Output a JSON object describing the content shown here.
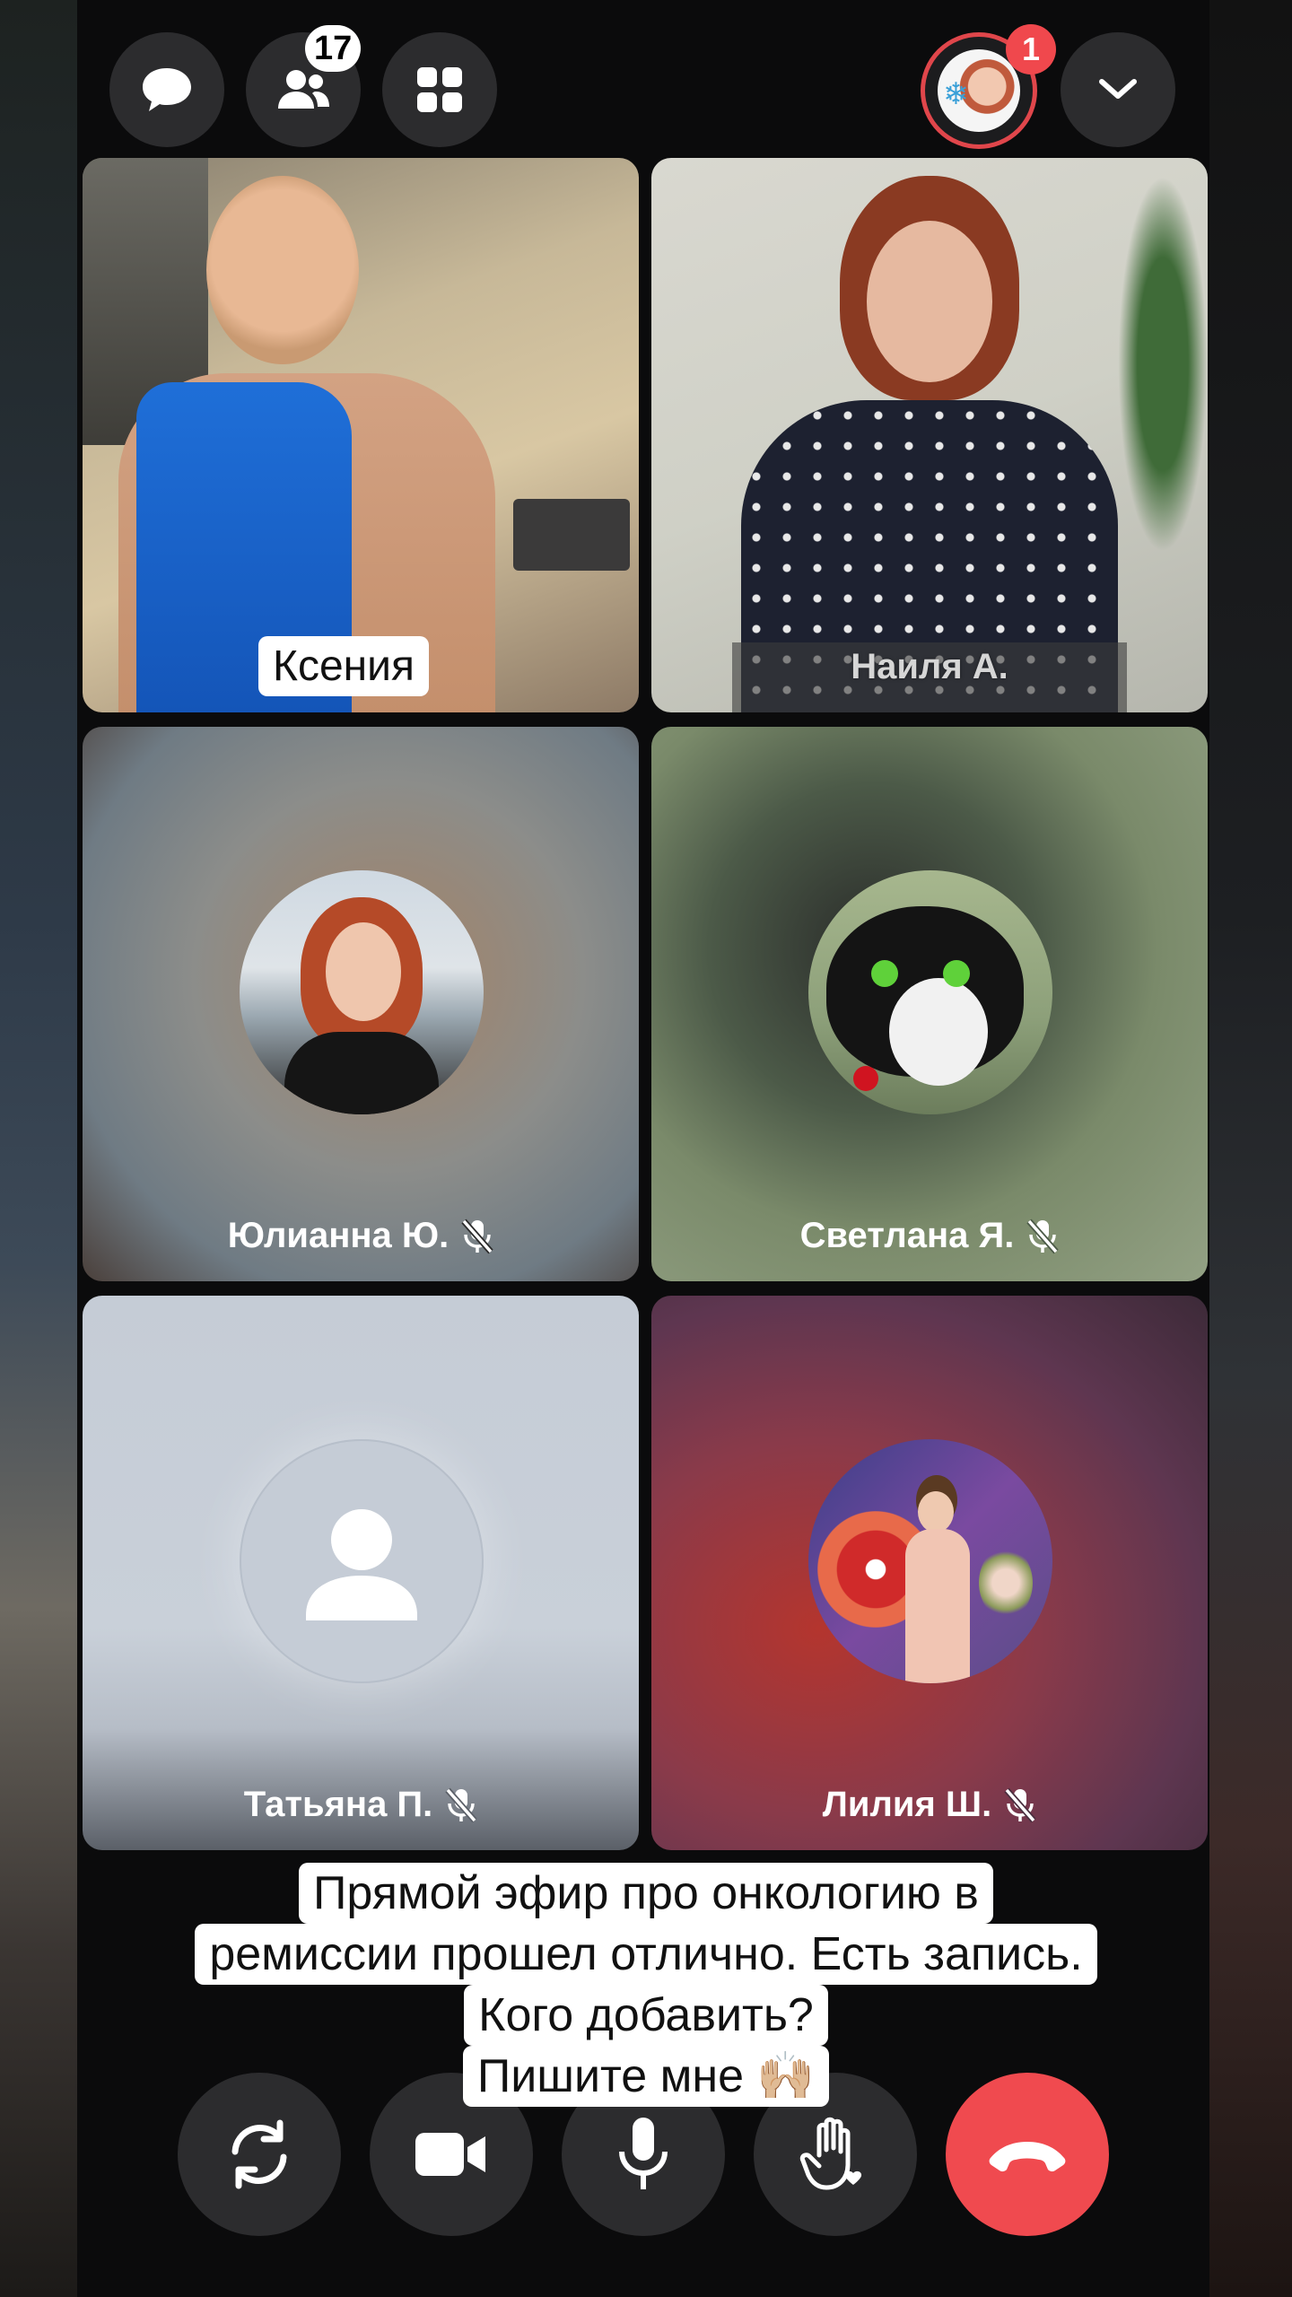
{
  "top_bar": {
    "participants_count": "17",
    "notifications_count": "1"
  },
  "tiles": [
    {
      "name": "Ксения"
    },
    {
      "name": "Наиля А."
    },
    {
      "name": "Юлианна Ю."
    },
    {
      "name": "Светлана Я."
    },
    {
      "name": "Татьяна П."
    },
    {
      "name": "Лилия Ш."
    }
  ],
  "caption": {
    "line1": "Прямой эфир  про онкологию в",
    "line2": "ремиссии прошел отлично. Есть запись.",
    "line3": "Кого добавить?",
    "line4": "Пишите мне 🙌🏼"
  },
  "icons": {
    "chat": "chat-bubble-icon",
    "participants": "people-icon",
    "grid": "grid-icon",
    "collapse": "chevron-down-icon",
    "switch_camera": "rotate-camera-icon",
    "camera": "video-camera-icon",
    "mic": "microphone-icon",
    "reaction": "raise-hand-icon",
    "hangup": "phone-hangup-icon",
    "muted": "mic-off-icon"
  },
  "colors": {
    "hangup": "#f04a4f",
    "badge_red": "#f0484d",
    "button_bg": "#2c2c2e"
  }
}
